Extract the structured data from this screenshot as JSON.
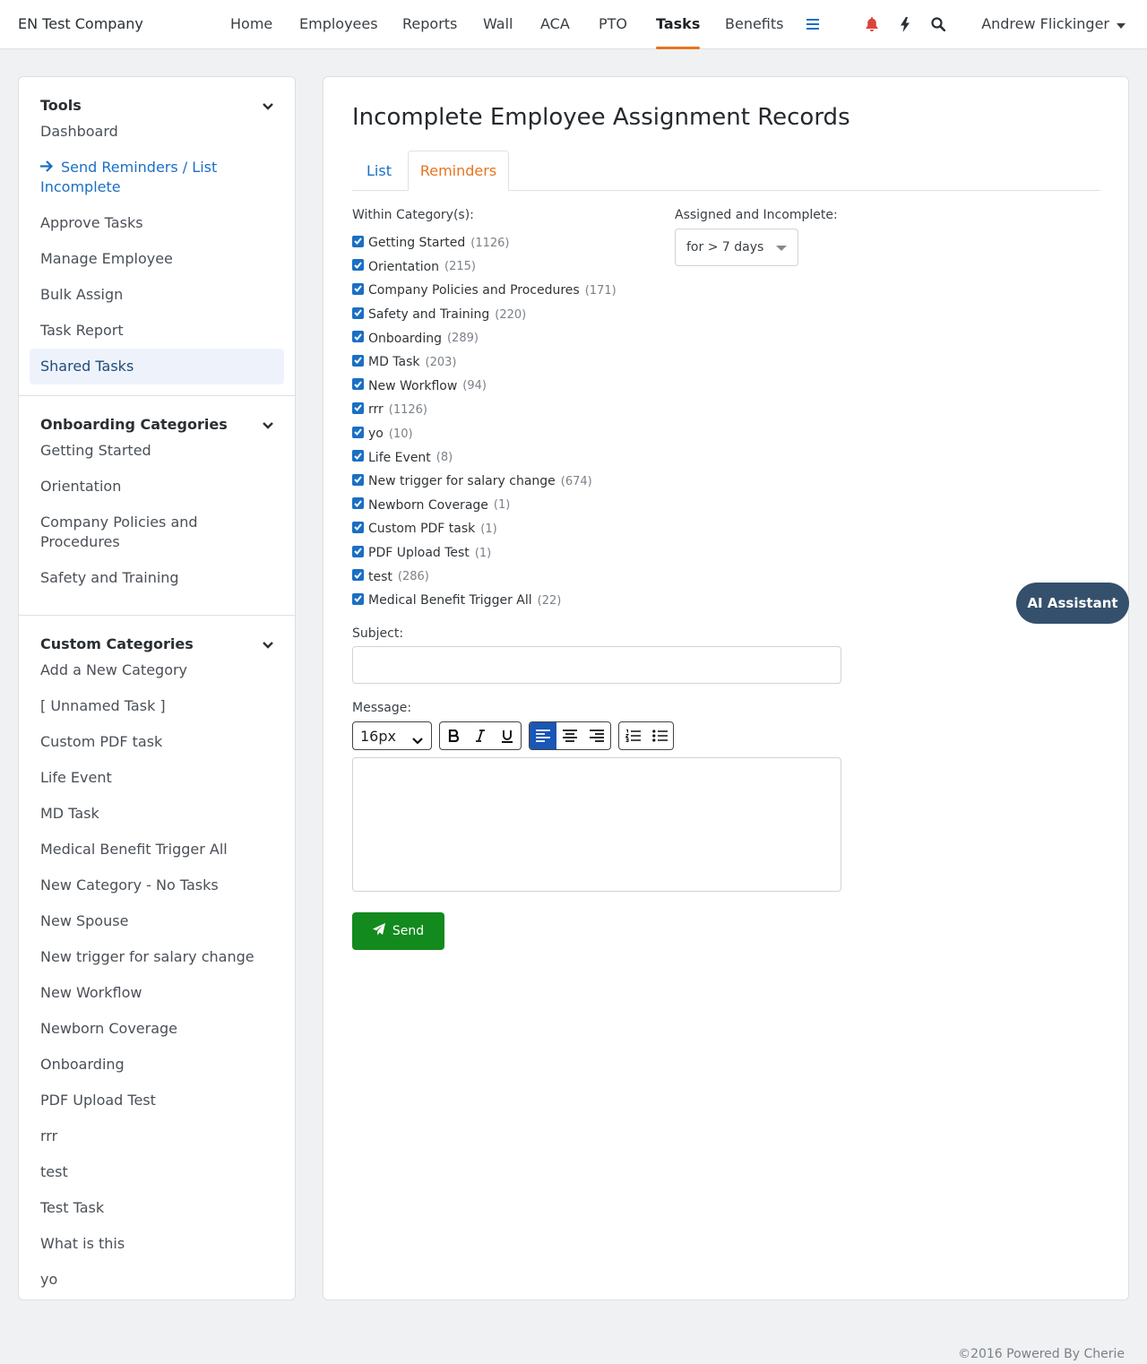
{
  "header": {
    "brand": "EN Test Company",
    "nav": [
      "Home",
      "Employees",
      "Reports",
      "Wall",
      "ACA",
      "PTO",
      "Tasks",
      "Benefits"
    ],
    "active_nav": "Tasks",
    "user": "Andrew Flickinger",
    "icons": [
      "menu-icon",
      "bell-icon",
      "bolt-icon",
      "search-icon"
    ]
  },
  "sidebar": {
    "tools": {
      "title": "Tools",
      "items": [
        "Dashboard",
        "Send Reminders / List Incomplete",
        "Approve Tasks",
        "Manage Employee",
        "Bulk Assign",
        "Task Report",
        "Shared Tasks"
      ]
    },
    "onboarding": {
      "title": "Onboarding Categories",
      "items": [
        "Getting Started",
        "Orientation",
        "Company Policies and Procedures",
        "Safety and Training"
      ]
    },
    "custom": {
      "title": "Custom Categories",
      "items": [
        "Add a New Category",
        "[ Unnamed Task ]",
        "Custom PDF task",
        "Life Event",
        "MD Task",
        "Medical Benefit Trigger All",
        "New Category - No Tasks",
        "New Spouse",
        "New trigger for salary change",
        "New Workflow",
        "Newborn Coverage",
        "Onboarding",
        "PDF Upload Test",
        "rrr",
        "test",
        "Test Task",
        "What is this",
        "yo"
      ]
    }
  },
  "main": {
    "title": "Incomplete Employee Assignment Records",
    "tabs": [
      "List",
      "Reminders"
    ],
    "within_label": "Within Category(s):",
    "assigned_label": "Assigned and Incomplete:",
    "assigned_value": "for > 7 days",
    "categories": [
      {
        "name": "Getting Started",
        "count": "(1126)"
      },
      {
        "name": "Orientation",
        "count": "(215)"
      },
      {
        "name": "Company Policies and Procedures",
        "count": "(171)"
      },
      {
        "name": "Safety and Training",
        "count": "(220)"
      },
      {
        "name": "Onboarding",
        "count": "(289)"
      },
      {
        "name": "MD Task",
        "count": "(203)"
      },
      {
        "name": "New Workflow",
        "count": "(94)"
      },
      {
        "name": "rrr",
        "count": "(1126)"
      },
      {
        "name": "yo",
        "count": "(10)"
      },
      {
        "name": "Life Event",
        "count": "(8)"
      },
      {
        "name": "New trigger for salary change",
        "count": "(674)"
      },
      {
        "name": "Newborn Coverage",
        "count": "(1)"
      },
      {
        "name": "Custom PDF task",
        "count": "(1)"
      },
      {
        "name": "PDF Upload Test",
        "count": "(1)"
      },
      {
        "name": "test",
        "count": "(286)"
      },
      {
        "name": "Medical Benefit Trigger All",
        "count": "(22)"
      }
    ],
    "subject_label": "Subject:",
    "subject_value": "",
    "message_label": "Message:",
    "font_size": "16px",
    "send_label": "Send"
  },
  "ai_assistant": "AI Assistant",
  "footer": "©2016 Powered By Cherie",
  "colors": {
    "accent": "#e8731f",
    "link": "#1a6fc4",
    "send": "#138a1d",
    "ai": "#35506d"
  }
}
